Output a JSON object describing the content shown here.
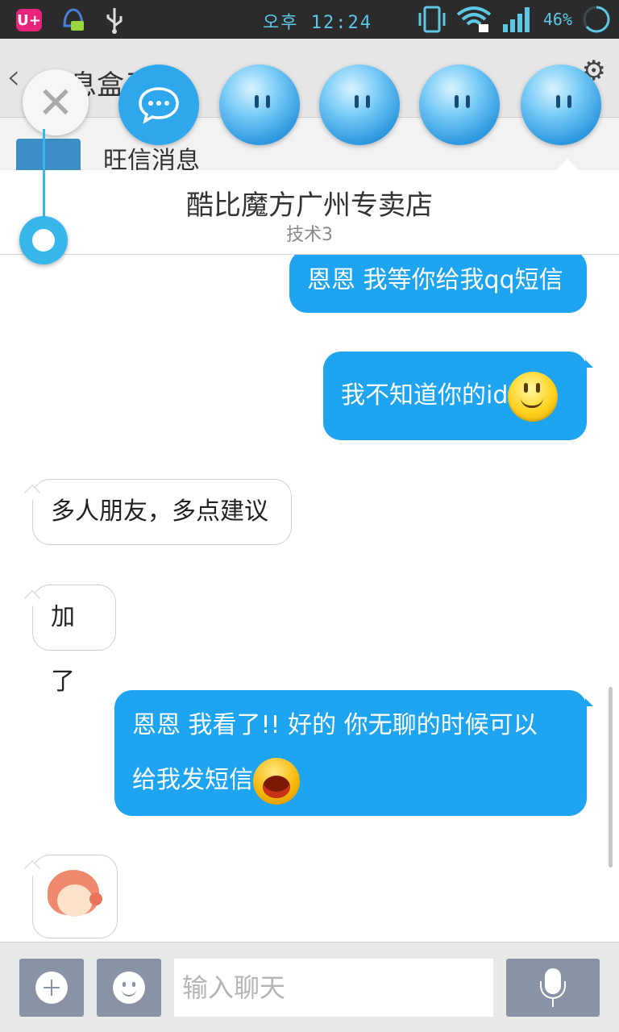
{
  "status_bar": {
    "carrier_badge": "U+",
    "time": "오후 12:24",
    "battery": "46%",
    "icons": [
      "uplus-icon",
      "chat-bell-icon",
      "usb-icon",
      "vibrate-icon",
      "wifi-lock-icon",
      "signal-icon",
      "battery-ring-icon"
    ]
  },
  "background_header": {
    "title": "消息盒子",
    "row_title": "旺信消息"
  },
  "conversation": {
    "title": "酷比魔方广州专卖店",
    "subtitle": "技术3"
  },
  "messages": [
    {
      "direction": "out",
      "text": "恩恩 我等你给我qq短信"
    },
    {
      "direction": "out",
      "text": "我不知道你的id",
      "emoji": "smiley"
    },
    {
      "direction": "in",
      "text": "多人朋友，多点建议"
    },
    {
      "direction": "in",
      "text": "加了"
    },
    {
      "direction": "out",
      "line1": "恩恩 我看了!! 好的 你无聊的时候可以",
      "line2": "给我发短信",
      "emoji": "laugh"
    },
    {
      "direction": "in",
      "sticker": "girl-wink-sticker"
    }
  ],
  "input_bar": {
    "placeholder": "输入聊天"
  },
  "colors": {
    "outgoing_bubble": "#1ea4f0",
    "status_bar": "#2b2b2b",
    "status_text": "#5fc7e6",
    "input_buttons": "#8a93a6"
  }
}
